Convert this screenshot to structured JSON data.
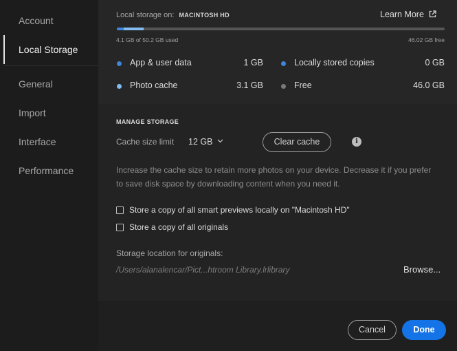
{
  "sidebar": {
    "items": [
      {
        "label": "Account"
      },
      {
        "label": "Local Storage"
      },
      {
        "label": "General"
      },
      {
        "label": "Import"
      },
      {
        "label": "Interface"
      },
      {
        "label": "Performance"
      }
    ]
  },
  "storage": {
    "label": "Local storage on:",
    "drive": "MACINTOSH HD",
    "learn_more": "Learn More",
    "used_text": "4.1 GB of 50.2 GB used",
    "free_text": "46.02 GB free",
    "used_fraction": 0.082,
    "segments": [
      {
        "fraction": 0.02,
        "color": "#3f86d8"
      },
      {
        "fraction": 0.062,
        "color": "#82bcf2"
      }
    ],
    "legend": [
      {
        "label": "App & user data",
        "value": "1 GB",
        "color": "#3f86d8"
      },
      {
        "label": "Locally stored copies",
        "value": "0 GB",
        "color": "#3f86d8"
      },
      {
        "label": "Photo cache",
        "value": "3.1 GB",
        "color": "#82bcf2"
      },
      {
        "label": "Free",
        "value": "46.0 GB",
        "color": "#7a7a7a"
      }
    ]
  },
  "manage": {
    "heading": "MANAGE STORAGE",
    "cache_label": "Cache size limit",
    "cache_value": "12 GB",
    "clear_cache": "Clear cache",
    "description_line1": "Increase the cache size to retain more photos on your device. Decrease it if you prefer",
    "description_line2": "to save disk space by downloading content when you need it.",
    "checkbox_previews": "Store a copy of all smart previews locally on \"Macintosh HD\"",
    "checkbox_originals": "Store a copy of all originals",
    "location_label": "Storage location for originals:",
    "location_path": "/Users/alanalencar/Pict...htroom Library.lrlibrary",
    "browse": "Browse..."
  },
  "footer": {
    "cancel": "Cancel",
    "done": "Done"
  },
  "colors": {
    "accent": "#1473e6"
  }
}
